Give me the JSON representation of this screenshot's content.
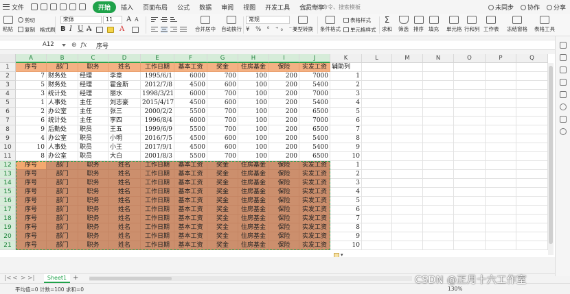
{
  "menubar": {
    "file_label": "文件",
    "menus": [
      "开始",
      "插入",
      "页面布局",
      "公式",
      "数据",
      "审阅",
      "视图",
      "开发工具",
      "会员专享"
    ],
    "active_menu": "开始",
    "search_placeholder": "查找命令、搜索模板",
    "right": [
      "未同步",
      "协作",
      "分享"
    ]
  },
  "toolbar": {
    "paste": "粘贴",
    "cut": "剪切",
    "copy": "复制",
    "format_painter": "格式刷",
    "font_name": "宋体",
    "font_size": "11",
    "bold": "B",
    "italic": "I",
    "underline": "U",
    "merge_center": "合并居中",
    "wrap_text": "自动换行",
    "number_format": "常规",
    "type_convert": "类型转换",
    "conditional_format": "条件格式",
    "table_style": "表格样式",
    "cell_style": "单元格样式",
    "sum": "求和",
    "filter": "筛选",
    "sort": "排序",
    "fill": "填充",
    "cell": "单元格",
    "rows_cols": "行和列",
    "worksheet": "工作表",
    "freeze": "冻结窗格",
    "table_tools": "表格工具"
  },
  "formula_bar": {
    "name_box": "A12",
    "formula": "序号"
  },
  "columns": [
    "A",
    "B",
    "C",
    "D",
    "E",
    "F",
    "G",
    "H",
    "I",
    "J",
    "K",
    "L",
    "M",
    "N",
    "O",
    "P",
    "Q"
  ],
  "rows": [
    "1",
    "2",
    "3",
    "4",
    "5",
    "6",
    "7",
    "8",
    "9",
    "10",
    "11",
    "12",
    "13",
    "14",
    "15",
    "16",
    "17",
    "18",
    "19",
    "20",
    "21"
  ],
  "header_row": [
    "序号",
    "部门",
    "职务",
    "姓名",
    "工作日期",
    "基本工资",
    "奖金",
    "住房基金",
    "保险",
    "实发工资"
  ],
  "helper_header": "辅助列",
  "data_rows": [
    [
      "7",
      "财务处",
      "经理",
      "李章",
      "1995/6/1",
      "6000",
      "700",
      "100",
      "200",
      "7000",
      "1"
    ],
    [
      "5",
      "财务处",
      "经理",
      "霍金斯",
      "2012/7/8",
      "4500",
      "600",
      "100",
      "200",
      "5400",
      "2"
    ],
    [
      "3",
      "统计处",
      "经理",
      "丽水",
      "1998/3/21",
      "6000",
      "700",
      "100",
      "200",
      "7000",
      "3"
    ],
    [
      "1",
      "人事处",
      "主任",
      "刘志豪",
      "2015/4/17",
      "4500",
      "600",
      "100",
      "200",
      "5400",
      "4"
    ],
    [
      "2",
      "办公室",
      "主任",
      "张三",
      "2000/2/2",
      "5500",
      "700",
      "100",
      "200",
      "6500",
      "5"
    ],
    [
      "6",
      "统计处",
      "主任",
      "李四",
      "1996/8/4",
      "6000",
      "700",
      "100",
      "200",
      "7000",
      "6"
    ],
    [
      "9",
      "后勤处",
      "职员",
      "王五",
      "1999/6/9",
      "5500",
      "700",
      "100",
      "200",
      "6500",
      "7"
    ],
    [
      "4",
      "办公室",
      "职员",
      "小明",
      "2016/7/5",
      "4500",
      "600",
      "100",
      "200",
      "5400",
      "8"
    ],
    [
      "10",
      "人事处",
      "职员",
      "小王",
      "2017/9/1",
      "4500",
      "600",
      "100",
      "200",
      "5400",
      "9"
    ],
    [
      "8",
      "办公室",
      "职员",
      "大白",
      "2001/8/3",
      "5500",
      "700",
      "100",
      "200",
      "6500",
      "10"
    ]
  ],
  "pasted_helper": [
    "1",
    "2",
    "3",
    "4",
    "5",
    "6",
    "7",
    "8",
    "9",
    "10"
  ],
  "sheet_tab": "Sheet1",
  "status": {
    "left": "平均值=0  计数=100  求和=0",
    "zoom": "130%"
  },
  "watermark": "CSDN @正月十六工作室",
  "colors": {
    "accent": "#1fa24a",
    "header_fill": "#f4b183",
    "pasted_fill": "#cc8f6d",
    "selection_border": "#27a152"
  }
}
